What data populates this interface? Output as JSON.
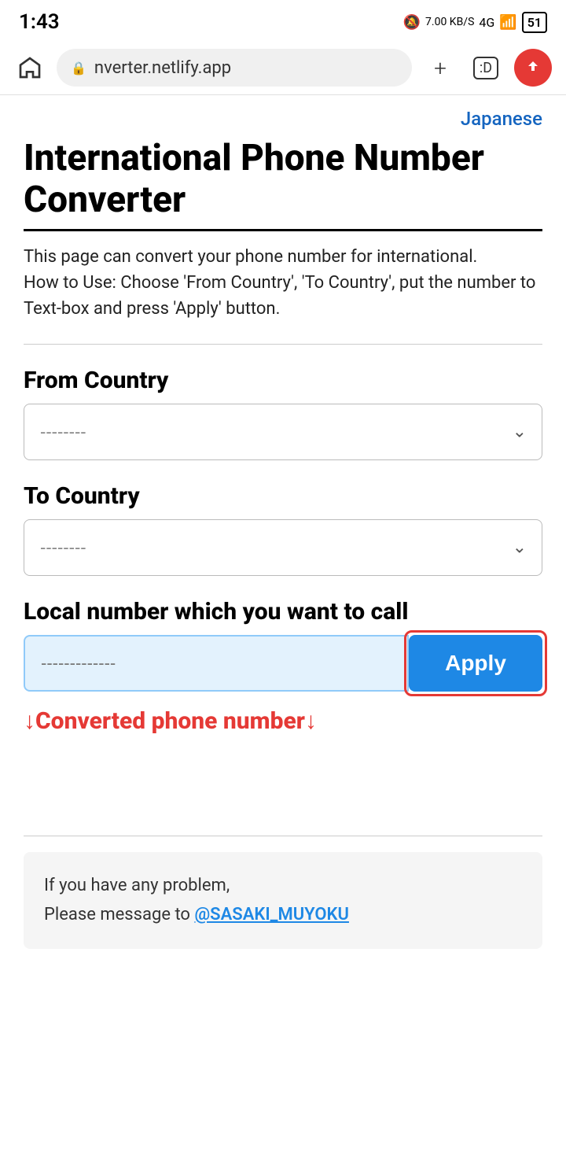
{
  "statusBar": {
    "time": "1:43",
    "batteryLevel": "51",
    "dataRate": "7.00 KB/S",
    "networkType": "4G"
  },
  "browserBar": {
    "url": "nverter.netlify.app",
    "plusLabel": "+",
    "tabLabel": ":D"
  },
  "page": {
    "langLink": "Japanese",
    "title": "International Phone Number Converter",
    "dividerVisible": true,
    "description1": "This page can convert your phone number for international.",
    "description2": "How to Use: Choose 'From Country', 'To Country', put the number to Text-box and press 'Apply' button.",
    "fromCountryLabel": "From Country",
    "fromCountryPlaceholder": "--------",
    "toCountryLabel": "To Country",
    "toCountryPlaceholder": "--------",
    "localNumberLabel": "Local number which you want to call",
    "localNumberPlaceholder": "-------------",
    "applyButtonLabel": "Apply",
    "convertedLabel": "↓Converted phone number↓",
    "footer": {
      "line1": "If you have any problem,",
      "line2": "Please message to ",
      "link": "@SASAKI_MUYOKU"
    }
  }
}
